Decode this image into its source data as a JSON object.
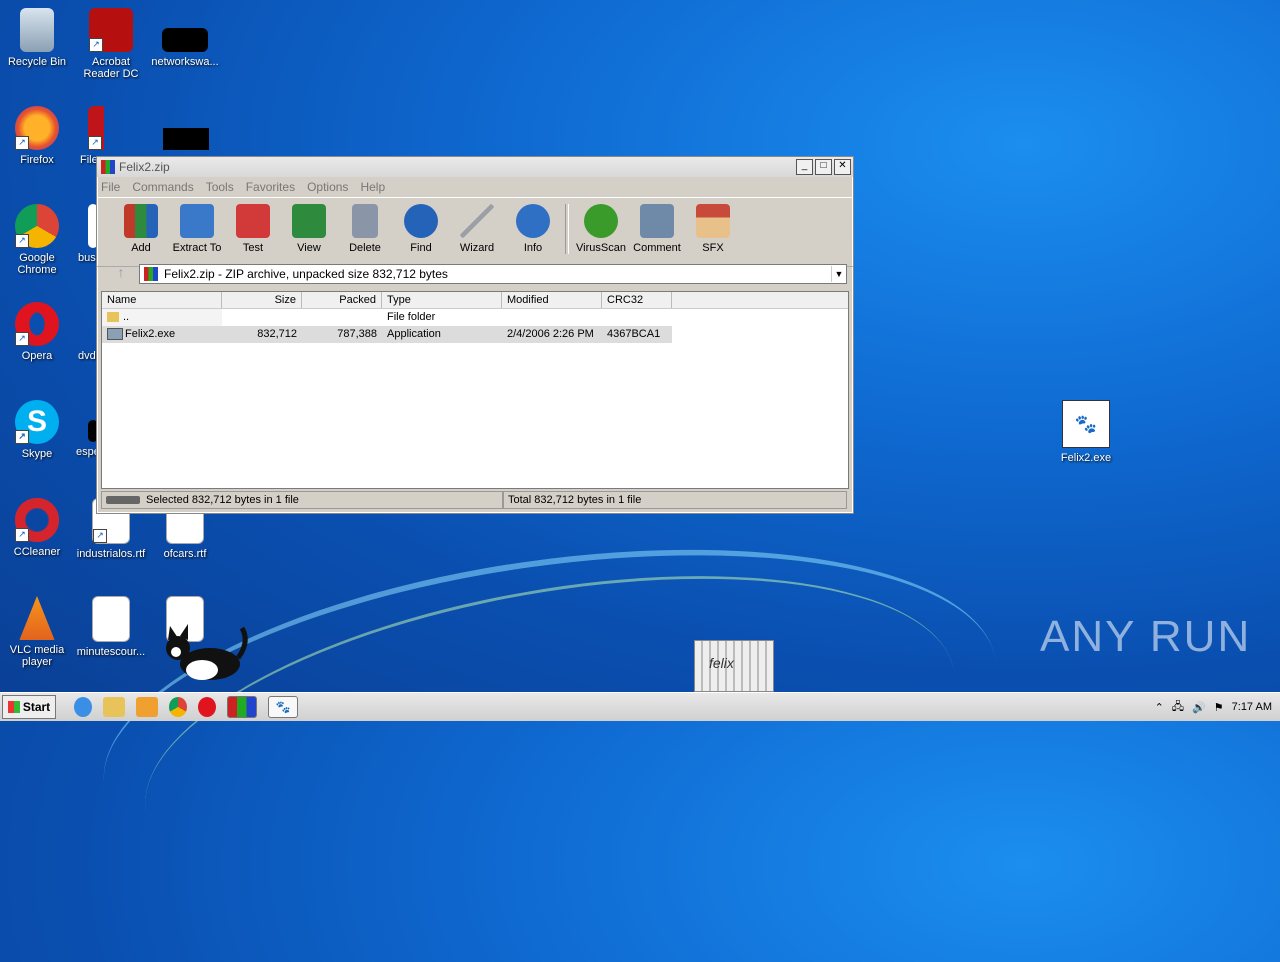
{
  "desktop_icons": [
    {
      "label": "Recycle Bin"
    },
    {
      "label": "Acrobat Reader DC"
    },
    {
      "label": "networkswa..."
    },
    {
      "label": "Firefox"
    },
    {
      "label": "File"
    },
    {
      "label": "Google Chrome"
    },
    {
      "label": "bus"
    },
    {
      "label": "Opera"
    },
    {
      "label": "dvd"
    },
    {
      "label": "Skype"
    },
    {
      "label": "espe"
    },
    {
      "label": "CCleaner"
    },
    {
      "label": "industrialos.rtf"
    },
    {
      "label": "ofcars.rtf"
    },
    {
      "label": "VLC media player"
    },
    {
      "label": "minutescour..."
    },
    {
      "label": "Felix2.exe"
    }
  ],
  "window": {
    "title": "Felix2.zip",
    "controls": {
      "minimize": "_",
      "maximize": "□",
      "close": "✕"
    },
    "menu": [
      "File",
      "Commands",
      "Tools",
      "Favorites",
      "Options",
      "Help"
    ],
    "toolbar": [
      {
        "label": "Add",
        "color": "#c0392b"
      },
      {
        "label": "Extract To",
        "color": "#3a78c9"
      },
      {
        "label": "Test",
        "color": "#d23a3a"
      },
      {
        "label": "View",
        "color": "#2e8b3e"
      },
      {
        "label": "Delete",
        "color": "#8a96a8"
      },
      {
        "label": "Find",
        "color": "#2563b8"
      },
      {
        "label": "Wizard",
        "color": "#9aa0a6"
      },
      {
        "label": "Info",
        "color": "#2f6fc4"
      },
      {
        "label": "VirusScan",
        "color": "#3a9a2a"
      },
      {
        "label": "Comment",
        "color": "#6f8aa8"
      },
      {
        "label": "SFX",
        "color": "#c84a3a"
      }
    ],
    "address": "Felix2.zip - ZIP archive, unpacked size 832,712 bytes",
    "columns": [
      "Name",
      "Size",
      "Packed",
      "Type",
      "Modified",
      "CRC32"
    ],
    "rows": [
      {
        "name": "..",
        "size": "",
        "packed": "",
        "type": "File folder",
        "modified": "",
        "crc": ""
      },
      {
        "name": "Felix2.exe",
        "size": "832,712",
        "packed": "787,388",
        "type": "Application",
        "modified": "2/4/2006 2:26 PM",
        "crc": "4367BCA1"
      }
    ],
    "status_left": "Selected 832,712 bytes in 1 file",
    "status_right": "Total 832,712 bytes in 1 file"
  },
  "taskbar": {
    "start_label": "Start",
    "clock": "7:17 AM"
  },
  "watermark": "ANY RUN",
  "box_text": "felix"
}
